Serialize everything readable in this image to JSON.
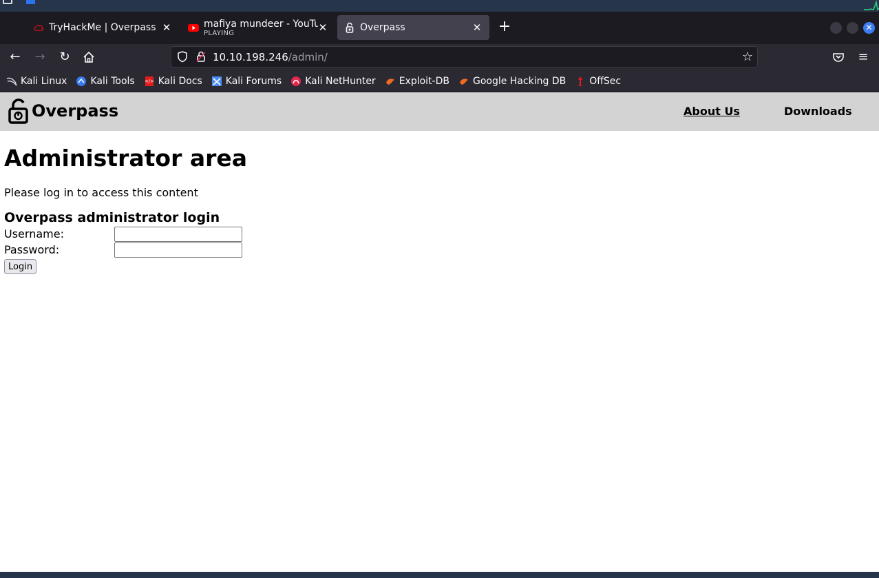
{
  "browser": {
    "tabs": [
      {
        "title": "TryHackMe | Overpass",
        "active": false
      },
      {
        "title": "mafiya mundeer - YouTube",
        "subtitle": "PLAYING",
        "active": false
      },
      {
        "title": "Overpass",
        "active": true
      }
    ],
    "url": {
      "host": "10.10.198.246",
      "path": "/admin/"
    },
    "bookmarks": [
      "Kali Linux",
      "Kali Tools",
      "Kali Docs",
      "Kali Forums",
      "Kali NetHunter",
      "Exploit-DB",
      "Google Hacking DB",
      "OffSec"
    ],
    "colors": {
      "accent": "#3d7cf2",
      "youtube": "#ff0000"
    }
  },
  "site": {
    "title": "Overpass",
    "nav": {
      "about": "About Us",
      "downloads": "Downloads"
    }
  },
  "main": {
    "heading": "Administrator area",
    "intro": "Please log in to access this content",
    "login_title": "Overpass administrator login",
    "username_label": "Username:",
    "password_label": "Password:",
    "login_button": "Login"
  }
}
